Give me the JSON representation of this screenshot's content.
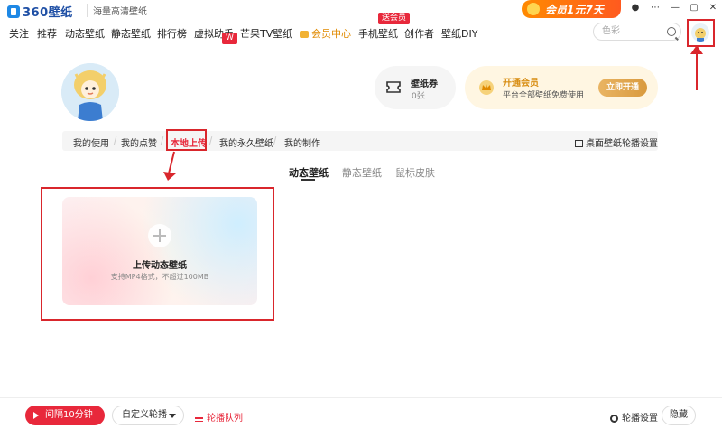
{
  "app": {
    "logo_text": "360壁纸",
    "slogan": "海量高清壁纸"
  },
  "promo": {
    "label": "会员1元7天"
  },
  "window_controls": {
    "skin": "●",
    "menu": "⋯",
    "minimize": "—",
    "maximize": "▢",
    "close": "✕"
  },
  "nav": {
    "items": [
      "关注",
      "推荐",
      "动态壁纸",
      "静态壁纸",
      "排行榜",
      "虚拟助手",
      "芒果TV壁纸",
      "会员中心",
      "手机壁纸",
      "创作者",
      "壁纸DIY"
    ],
    "badges": {
      "virtual_assistant": "W",
      "mobile_wallpaper": "送会员"
    }
  },
  "search": {
    "placeholder": "色彩"
  },
  "profile": {
    "voucher": {
      "title": "壁纸券",
      "value": "0张"
    },
    "vip": {
      "title": "开通会员",
      "subtitle": "平台全部壁纸免费使用",
      "button": "立即开通"
    }
  },
  "tabs": {
    "items": [
      "我的使用",
      "我的点赞",
      "本地上传",
      "我的永久壁纸",
      "我的制作"
    ],
    "active": "本地上传",
    "rotation_setting": "桌面壁纸轮播设置"
  },
  "subtabs": {
    "items": [
      "动态壁纸",
      "静态壁纸",
      "鼠标皮肤"
    ],
    "active": "动态壁纸"
  },
  "upload": {
    "title": "上传动态壁纸",
    "hint": "支持MP4格式，不超过100MB"
  },
  "bottom": {
    "interval": "间隔10分钟",
    "custom_rotation": "自定义轮播",
    "queue": "轮播队列",
    "settings": "轮播设置",
    "hide": "隐藏"
  },
  "colors": {
    "accent": "#e8283b",
    "vip_gold": "#e08a00",
    "annotation": "#d9262c"
  }
}
